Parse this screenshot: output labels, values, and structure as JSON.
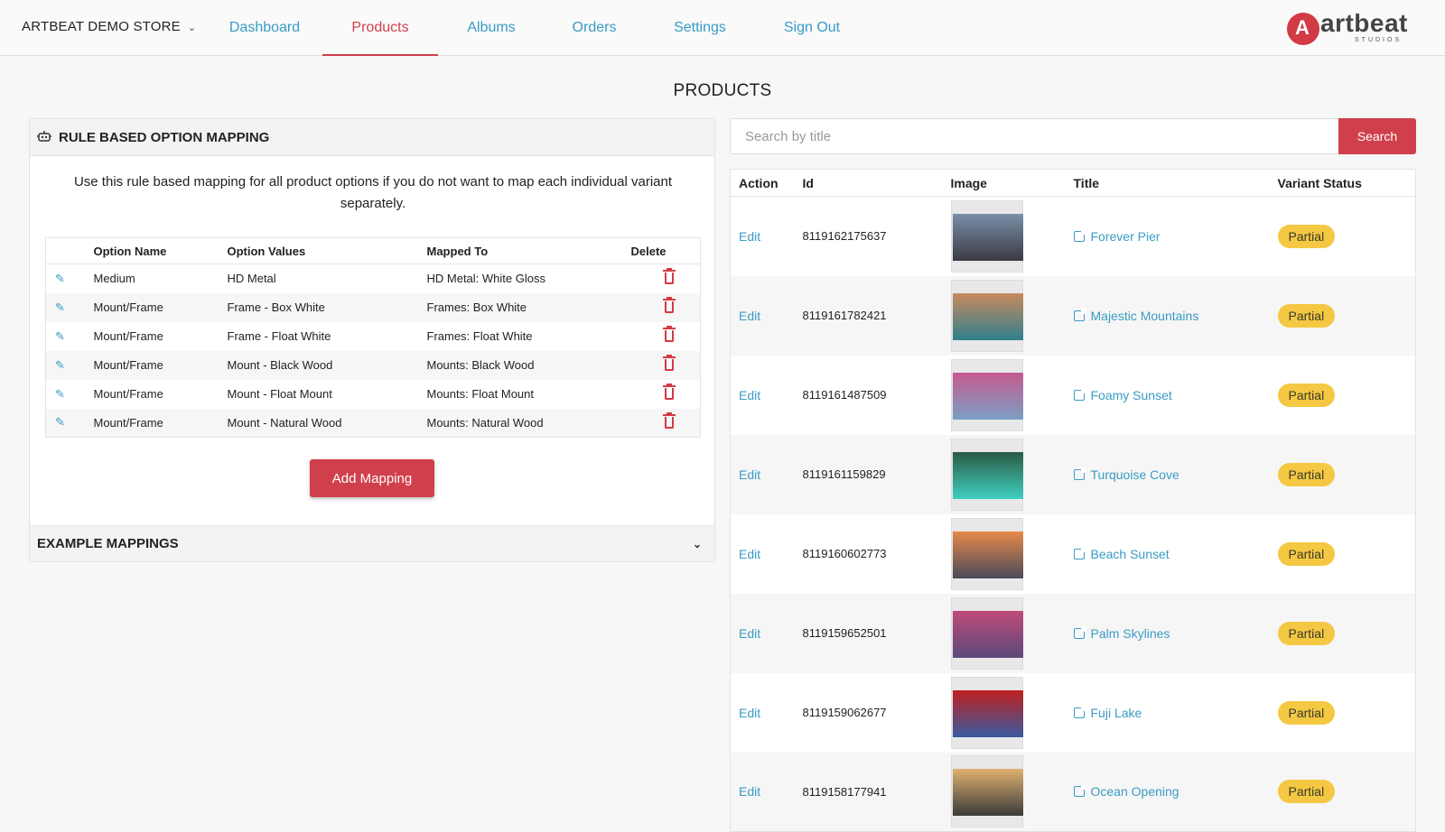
{
  "header": {
    "store_name": "ARTBEAT DEMO STORE",
    "nav": [
      {
        "label": "Dashboard"
      },
      {
        "label": "Products"
      },
      {
        "label": "Albums"
      },
      {
        "label": "Orders"
      },
      {
        "label": "Settings"
      },
      {
        "label": "Sign Out"
      }
    ],
    "active_tab": "Products",
    "logo_text": "artbeat",
    "logo_sub": "STUDIOS"
  },
  "page_title": "PRODUCTS",
  "rule_panel": {
    "title": "RULE BASED OPTION MAPPING",
    "description": "Use this rule based mapping for all product options if you do not want to map each individual variant separately.",
    "columns": [
      "Option Name",
      "Option Values",
      "Mapped To",
      "Delete"
    ],
    "rows": [
      {
        "name": "Medium",
        "value": "HD Metal",
        "mapped": "HD Metal: White Gloss"
      },
      {
        "name": "Mount/Frame",
        "value": "Frame - Box White",
        "mapped": "Frames: Box White"
      },
      {
        "name": "Mount/Frame",
        "value": "Frame - Float White",
        "mapped": "Frames: Float White"
      },
      {
        "name": "Mount/Frame",
        "value": "Mount - Black Wood",
        "mapped": "Mounts: Black Wood"
      },
      {
        "name": "Mount/Frame",
        "value": "Mount - Float Mount",
        "mapped": "Mounts: Float Mount"
      },
      {
        "name": "Mount/Frame",
        "value": "Mount - Natural Wood",
        "mapped": "Mounts: Natural Wood"
      }
    ],
    "add_button": "Add Mapping",
    "example_title": "EXAMPLE MAPPINGS"
  },
  "search": {
    "placeholder": "Search by title",
    "button": "Search"
  },
  "products": {
    "columns": [
      "Action",
      "Id",
      "Image",
      "Title",
      "Variant Status"
    ],
    "rows": [
      {
        "action": "Edit",
        "id": "8119162175637",
        "title": "Forever Pier",
        "status": "Partial",
        "colors": [
          "#7a8fa8",
          "#3a3a44"
        ]
      },
      {
        "action": "Edit",
        "id": "8119161782421",
        "title": "Majestic Mountains",
        "status": "Partial",
        "colors": [
          "#c98a5e",
          "#2f7f8c"
        ]
      },
      {
        "action": "Edit",
        "id": "8119161487509",
        "title": "Foamy Sunset",
        "status": "Partial",
        "colors": [
          "#c65a8e",
          "#7a9fc4"
        ]
      },
      {
        "action": "Edit",
        "id": "8119161159829",
        "title": "Turquoise Cove",
        "status": "Partial",
        "colors": [
          "#2a5a44",
          "#3fd0c0"
        ]
      },
      {
        "action": "Edit",
        "id": "8119160602773",
        "title": "Beach Sunset",
        "status": "Partial",
        "colors": [
          "#e68a4a",
          "#4a4a5a"
        ]
      },
      {
        "action": "Edit",
        "id": "8119159652501",
        "title": "Palm Skylines",
        "status": "Partial",
        "colors": [
          "#c04a7a",
          "#5a4a7a"
        ]
      },
      {
        "action": "Edit",
        "id": "8119159062677",
        "title": "Fuji Lake",
        "status": "Partial",
        "colors": [
          "#c02020",
          "#3a5aa0"
        ]
      },
      {
        "action": "Edit",
        "id": "8119158177941",
        "title": "Ocean Opening",
        "status": "Partial",
        "colors": [
          "#e0b070",
          "#3a3a3a"
        ]
      }
    ]
  },
  "colors": {
    "accent_red": "#d0404c",
    "link_blue": "#3a9bc4",
    "badge_yellow": "#f4c842"
  }
}
